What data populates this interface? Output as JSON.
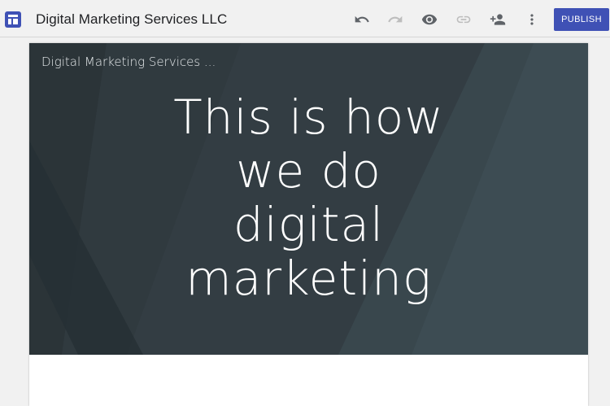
{
  "header": {
    "app_icon": "sites-layout-icon",
    "site_title": "Digital Marketing Services LLC",
    "tools": [
      {
        "name": "undo-icon"
      },
      {
        "name": "redo-icon"
      },
      {
        "name": "preview-eye-icon"
      },
      {
        "name": "link-icon"
      },
      {
        "name": "add-person-icon"
      },
      {
        "name": "more-vert-icon"
      }
    ],
    "publish_label": "PUBLISH"
  },
  "hero": {
    "site_name": "Digital Marketing Services ...",
    "heading": "This is how\nwe do\ndigital\nmarketing"
  },
  "colors": {
    "accent": "#3f51b5",
    "hero_bg": "#333d43",
    "toolbar_bg": "#f1f1f1"
  }
}
